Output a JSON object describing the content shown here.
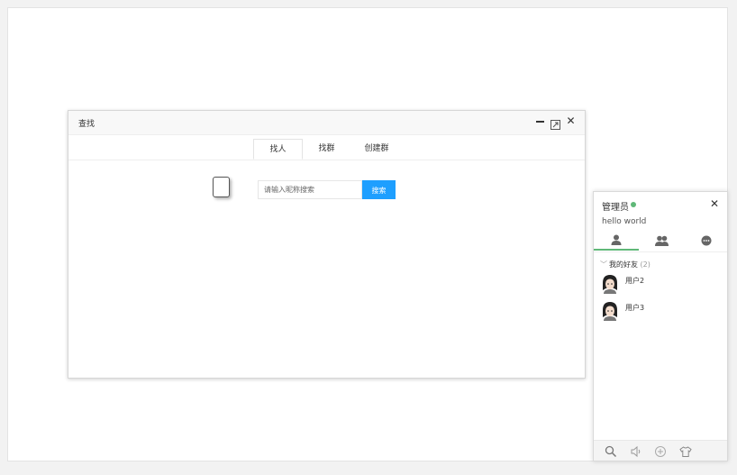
{
  "find_window": {
    "title": "查找",
    "tabs": [
      {
        "label": "找人",
        "active": true
      },
      {
        "label": "找群",
        "active": false
      },
      {
        "label": "创建群",
        "active": false
      }
    ],
    "search": {
      "placeholder": "请输入昵称搜索",
      "value": "",
      "button_label": "搜索",
      "button_color": "#1e9fff"
    }
  },
  "im_panel": {
    "username": "管理员",
    "status": "online",
    "status_color": "#5fb878",
    "sign": "hello world",
    "tabs": [
      {
        "icon": "user-icon",
        "active": true
      },
      {
        "icon": "group-icon",
        "active": false
      },
      {
        "icon": "chat-bubble-icon",
        "active": false
      }
    ],
    "friend_group": {
      "name": "我的好友",
      "count": "(2)",
      "friends": [
        {
          "name": "用户2"
        },
        {
          "name": "用户3"
        }
      ]
    },
    "footer_icons": [
      "search-icon",
      "sound-icon",
      "add-icon",
      "skin-icon"
    ]
  }
}
